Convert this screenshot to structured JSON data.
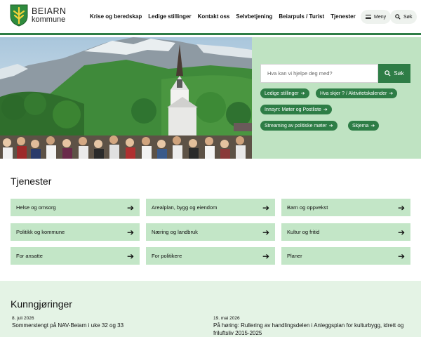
{
  "header": {
    "logo_name": "BEIARN",
    "logo_sub": "kommune",
    "nav": [
      "Krise og beredskap",
      "Ledige stillinger",
      "Kontakt oss",
      "Selvbetjening",
      "Beiarpuls / Turist",
      "Tjenester"
    ],
    "menu_label": "Meny",
    "search_label": "Søk"
  },
  "hero": {
    "search_placeholder": "Hva kan vi hjelpe deg med?",
    "search_button": "Søk",
    "quick_links": [
      "Ledige stillinger",
      "Hva skjer ? / Aktivitetskalender",
      "Innsyn: Møter og Postliste",
      "Streaming av politiske møter",
      "Skjema"
    ]
  },
  "services": {
    "title": "Tjenester",
    "tiles": [
      "Helse og omsorg",
      "Arealplan, bygg og eiendom",
      "Barn og oppvekst",
      "Politikk og kommune",
      "Næring og landbruk",
      "Kultur og fritid",
      "For ansatte",
      "For politikere",
      "Planer"
    ]
  },
  "announcements": {
    "title": "Kunngjøringer",
    "items": [
      {
        "date": "8. juli 2026",
        "title": "Sommerstengt på NAV-Beiarn i uke 32 og 33"
      },
      {
        "date": "19. mai 2026",
        "title": "På høring: Rullering av handlingsdelen i Anleggsplan for kulturbygg, idrett og friluftsliv 2015-2025"
      }
    ]
  },
  "colors": {
    "brand_green": "#2e7d46",
    "tile_green": "#c3e6c7",
    "panel_green": "#bfe3c2"
  }
}
